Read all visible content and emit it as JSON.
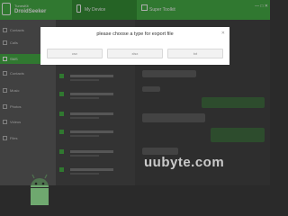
{
  "header": {
    "brand_line1": "TunesKit",
    "brand_line2": "DroidSeeker",
    "tabs": [
      {
        "label": "My Device"
      },
      {
        "label": "Super Toolkit"
      }
    ],
    "window_controls": "— □ ✕"
  },
  "sidebar": {
    "items": [
      {
        "label": "Contacts"
      },
      {
        "label": "Calls"
      },
      {
        "label": "SMS"
      },
      {
        "label": "Contacts"
      },
      {
        "label": "Music"
      },
      {
        "label": "Photos"
      },
      {
        "label": "Videos"
      },
      {
        "label": "Files"
      }
    ]
  },
  "dialog": {
    "title": "please choose a type for export file",
    "close": "✕",
    "buttons": [
      {
        "label": "csv"
      },
      {
        "label": "xlsx"
      },
      {
        "label": "txt"
      }
    ]
  },
  "watermark": "uubyte.com",
  "colors": {
    "accent": "#3fae3f",
    "sidebar_bg": "#5a5a5a",
    "dialog_bg": "#ffffff"
  }
}
